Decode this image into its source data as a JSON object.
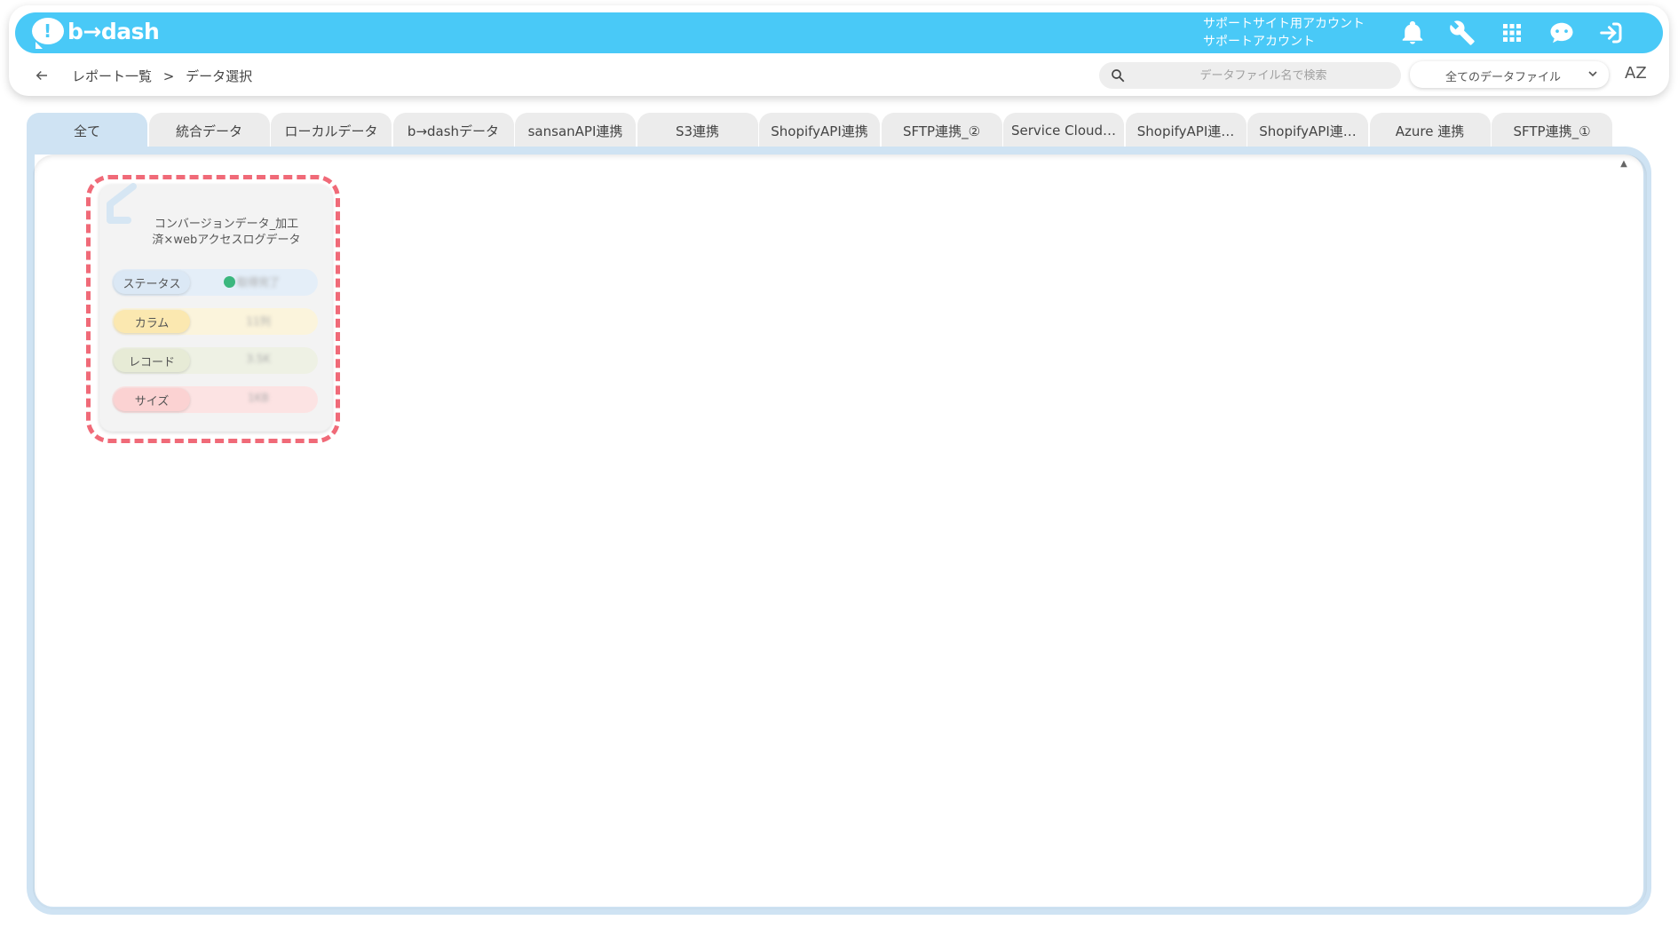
{
  "header": {
    "logo_text": "b→dash",
    "account_line1": "サポートサイト用アカウント",
    "account_line2": "サポートアカウント",
    "icons": [
      "bell-icon",
      "wrench-icon",
      "apps-grid-icon",
      "chat-bot-icon",
      "logout-icon"
    ]
  },
  "breadcrumb": {
    "parent": "レポート一覧",
    "separator": ">",
    "current": "データ選択"
  },
  "search": {
    "placeholder": "データファイル名で検索"
  },
  "filter": {
    "selected": "全てのデータファイル"
  },
  "sort": {
    "label": "AZ"
  },
  "tabs": [
    {
      "label": "全て",
      "active": true
    },
    {
      "label": "統合データ"
    },
    {
      "label": "ローカルデータ"
    },
    {
      "label": "b→dashデータ"
    },
    {
      "label": "sansanAPI連携"
    },
    {
      "label": "S3連携"
    },
    {
      "label": "ShopifyAPI連携"
    },
    {
      "label": "SFTP連携_②"
    },
    {
      "label": "Service Cloud…"
    },
    {
      "label": "ShopifyAPI連…"
    },
    {
      "label": "ShopifyAPI連…"
    },
    {
      "label": "Azure 連携"
    },
    {
      "label": "SFTP連携_①"
    }
  ],
  "card": {
    "title": "コンバージョンデータ_加工済×webアクセスログデータ",
    "rows": {
      "status": {
        "label": "ステータス",
        "value": "取得完了"
      },
      "column": {
        "label": "カラム",
        "value": "11列"
      },
      "record": {
        "label": "レコード",
        "value": "3.5K"
      },
      "size": {
        "label": "サイズ",
        "value": "1KB"
      }
    },
    "colors": {
      "highlight": "#f06a78",
      "status_ok": "#3bb77e"
    }
  },
  "colors": {
    "header": "#49c9f7",
    "tab_active": "#cfe3f3"
  }
}
